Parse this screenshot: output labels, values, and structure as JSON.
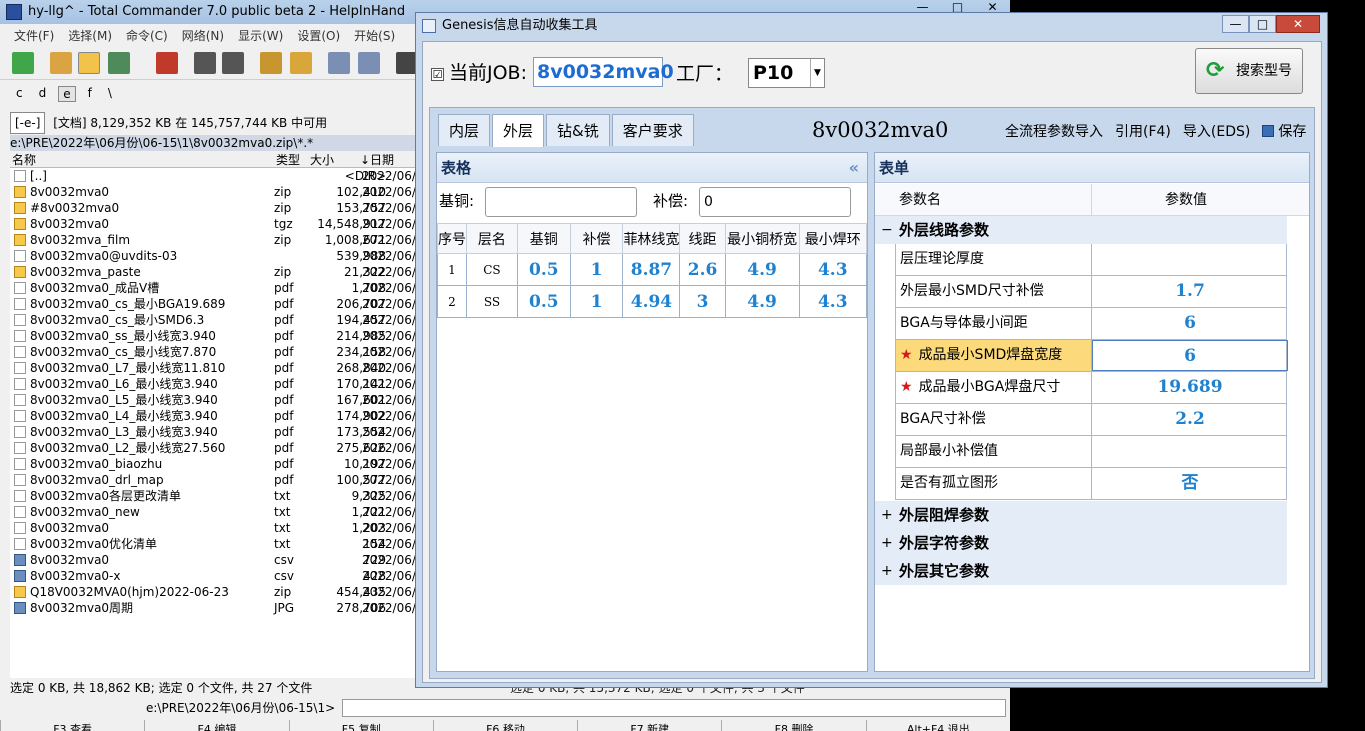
{
  "tc": {
    "title": "hy-llg^ - Total Commander 7.0 public beta 2 - HelpInHand",
    "win_buttons": [
      "—",
      "□",
      "✕"
    ],
    "menu": [
      "文件(F)",
      "选择(M)",
      "命令(C)",
      "网络(N)",
      "显示(W)",
      "设置(O)",
      "开始(S)"
    ],
    "drives": [
      "c",
      "d",
      "e",
      "f",
      "\\"
    ],
    "drive_select": "[-e-]",
    "free_space": "[文档]  8,129,352 KB 在 145,757,744 KB 中可用",
    "current_path": "e:\\PRE\\2022年\\06月份\\06-15\\1\\8v0032mva0.zip\\*.*",
    "columns": {
      "name": "名称",
      "type": "类型",
      "size": "大小",
      "date": "↓日期"
    },
    "files": [
      {
        "name": "[..]",
        "ext": "",
        "size": "<DIR>",
        "date": "2022/06/",
        "icon": "up"
      },
      {
        "name": "8v0032mva0",
        "ext": "zip",
        "size": "102,410",
        "date": "2022/06/",
        "icon": "archive"
      },
      {
        "name": "#8v0032mva0",
        "ext": "zip",
        "size": "153,757",
        "date": "2022/06/",
        "icon": "archive"
      },
      {
        "name": "8v0032mva0",
        "ext": "tgz",
        "size": "14,548,917",
        "date": "2022/06/",
        "icon": "archive"
      },
      {
        "name": "8v0032mva_film",
        "ext": "zip",
        "size": "1,008,671",
        "date": "2022/06/",
        "icon": "archive"
      },
      {
        "name": "8v0032mva0@uvdits-03",
        "ext": "",
        "size": "539,988",
        "date": "2022/06/",
        "icon": "doc"
      },
      {
        "name": "8v0032mva_paste",
        "ext": "zip",
        "size": "21,322",
        "date": "2022/06/",
        "icon": "archive"
      },
      {
        "name": "8v0032mva0_成品V槽",
        "ext": "pdf",
        "size": "1,708",
        "date": "2022/06/",
        "icon": "doc"
      },
      {
        "name": "8v0032mva0_cs_最小BGA19.689",
        "ext": "pdf",
        "size": "206,707",
        "date": "2022/06/",
        "icon": "doc"
      },
      {
        "name": "8v0032mva0_cs_最小SMD6.3",
        "ext": "pdf",
        "size": "194,457",
        "date": "2022/06/",
        "icon": "doc"
      },
      {
        "name": "8v0032mva0_ss_最小线宽3.940",
        "ext": "pdf",
        "size": "214,985",
        "date": "2022/06/",
        "icon": "doc"
      },
      {
        "name": "8v0032mva0_cs_最小线宽7.870",
        "ext": "pdf",
        "size": "234,158",
        "date": "2022/06/",
        "icon": "doc"
      },
      {
        "name": "8v0032mva0_L7_最小线宽11.810",
        "ext": "pdf",
        "size": "268,840",
        "date": "2022/06/",
        "icon": "doc"
      },
      {
        "name": "8v0032mva0_L6_最小线宽3.940",
        "ext": "pdf",
        "size": "170,141",
        "date": "2022/06/",
        "icon": "doc"
      },
      {
        "name": "8v0032mva0_L5_最小线宽3.940",
        "ext": "pdf",
        "size": "167,601",
        "date": "2022/06/",
        "icon": "doc"
      },
      {
        "name": "8v0032mva0_L4_最小线宽3.940",
        "ext": "pdf",
        "size": "174,902",
        "date": "2022/06/",
        "icon": "doc"
      },
      {
        "name": "8v0032mva0_L3_最小线宽3.940",
        "ext": "pdf",
        "size": "173,554",
        "date": "2022/06/",
        "icon": "doc"
      },
      {
        "name": "8v0032mva0_L2_最小线宽27.560",
        "ext": "pdf",
        "size": "275,626",
        "date": "2022/06/",
        "icon": "doc"
      },
      {
        "name": "8v0032mva0_biaozhu",
        "ext": "pdf",
        "size": "10,197",
        "date": "2022/06/",
        "icon": "doc"
      },
      {
        "name": "8v0032mva0_drl_map",
        "ext": "pdf",
        "size": "100,577",
        "date": "2022/06/",
        "icon": "doc"
      },
      {
        "name": "8v0032mva0各层更改清单",
        "ext": "txt",
        "size": "9,325",
        "date": "2022/06/",
        "icon": "doc"
      },
      {
        "name": "8v0032mva0_new",
        "ext": "txt",
        "size": "1,721",
        "date": "2022/06/",
        "icon": "doc"
      },
      {
        "name": "8v0032mva0",
        "ext": "txt",
        "size": "1,203",
        "date": "2022/06/",
        "icon": "doc"
      },
      {
        "name": "8v0032mva0优化清单",
        "ext": "txt",
        "size": "154",
        "date": "2022/06/",
        "icon": "doc"
      },
      {
        "name": "8v0032mva0",
        "ext": "csv",
        "size": "729",
        "date": "2022/06/",
        "icon": "img"
      },
      {
        "name": "8v0032mva0-x",
        "ext": "csv",
        "size": "428",
        "date": "2022/06/",
        "icon": "img"
      },
      {
        "name": "Q18V0032MVA0(hjm)2022-06-23",
        "ext": "zip",
        "size": "454,435",
        "date": "2022/06/",
        "icon": "archive"
      },
      {
        "name": "8v0032mva0周期",
        "ext": "JPG",
        "size": "278,706",
        "date": "2022/06/",
        "icon": "img"
      }
    ],
    "status_left": "选定 0 KB, 共 18,862 KB; 选定 0 个文件, 共 27 个文件",
    "status_right": "选定 0 KB, 共 15,372 KB; 选定 0 个文件, 共 3 个文件",
    "cmd_path": "e:\\PRE\\2022年\\06月份\\06-15\\1>",
    "fkeys": [
      "F3 查看",
      "F4 编辑",
      "F5 复制",
      "F6 移动",
      "F7 新建",
      "F8 删除",
      "Alt+F4 退出"
    ]
  },
  "genesis": {
    "title": "Genesis信息自动收集工具",
    "win_buttons": [
      "—",
      "□",
      "✕"
    ],
    "job_checkbox": "☑",
    "job_label": "当前JOB:",
    "job_value": "8v0032mva0",
    "factory_label": "工厂：",
    "factory_value": "P10",
    "search_label": "搜索型号",
    "tabs": [
      "内层",
      "外层",
      "钻&铣",
      "客户要求"
    ],
    "active_tab": "外层",
    "job_display": "8v0032mva0",
    "actions": {
      "import_all": "全流程参数导入",
      "quote": "引用(F4)",
      "import_eds": "导入(EDS)",
      "save": "保存"
    },
    "table_panel": {
      "title": "表格",
      "collapse": "«",
      "base_copper_label": "基铜:",
      "base_copper_value": "",
      "compensation_label": "补偿:",
      "compensation_value": "0",
      "columns": [
        "序号",
        "层名",
        "基铜",
        "补偿",
        "菲林线宽",
        "线距",
        "最小铜桥宽",
        "最小焊环"
      ],
      "rows": [
        [
          "1",
          "CS",
          "0.5",
          "1",
          "8.87",
          "2.6",
          "4.9",
          "4.3"
        ],
        [
          "2",
          "SS",
          "0.5",
          "1",
          "4.94",
          "3",
          "4.9",
          "4.3"
        ]
      ]
    },
    "form_panel": {
      "title": "表单",
      "col_name": "参数名",
      "col_value": "参数值",
      "group_open": "外层线路参数",
      "params": [
        {
          "name": "层压理论厚度",
          "value": "",
          "star": false
        },
        {
          "name": "外层最小SMD尺寸补偿",
          "value": "1.7",
          "star": false
        },
        {
          "name": "BGA与导体最小间距",
          "value": "6",
          "star": false
        },
        {
          "name": "成品最小SMD焊盘宽度",
          "value": "6",
          "star": true
        },
        {
          "name": "成品最小BGA焊盘尺寸",
          "value": "19.689",
          "star": true
        },
        {
          "name": "BGA尺寸补偿",
          "value": "2.2",
          "star": false
        },
        {
          "name": "局部最小补偿值",
          "value": "",
          "star": false
        },
        {
          "name": "是否有孤立图形",
          "value": "否",
          "star": false
        }
      ],
      "groups_closed": [
        "外层阻焊参数",
        "外层字符参数",
        "外层其它参数"
      ],
      "star_icon": "★",
      "minus": "−",
      "plus": "+"
    },
    "colors": {
      "accent": "#1e82d0",
      "highlight": "#fcd97a",
      "star": "#d81919"
    }
  }
}
